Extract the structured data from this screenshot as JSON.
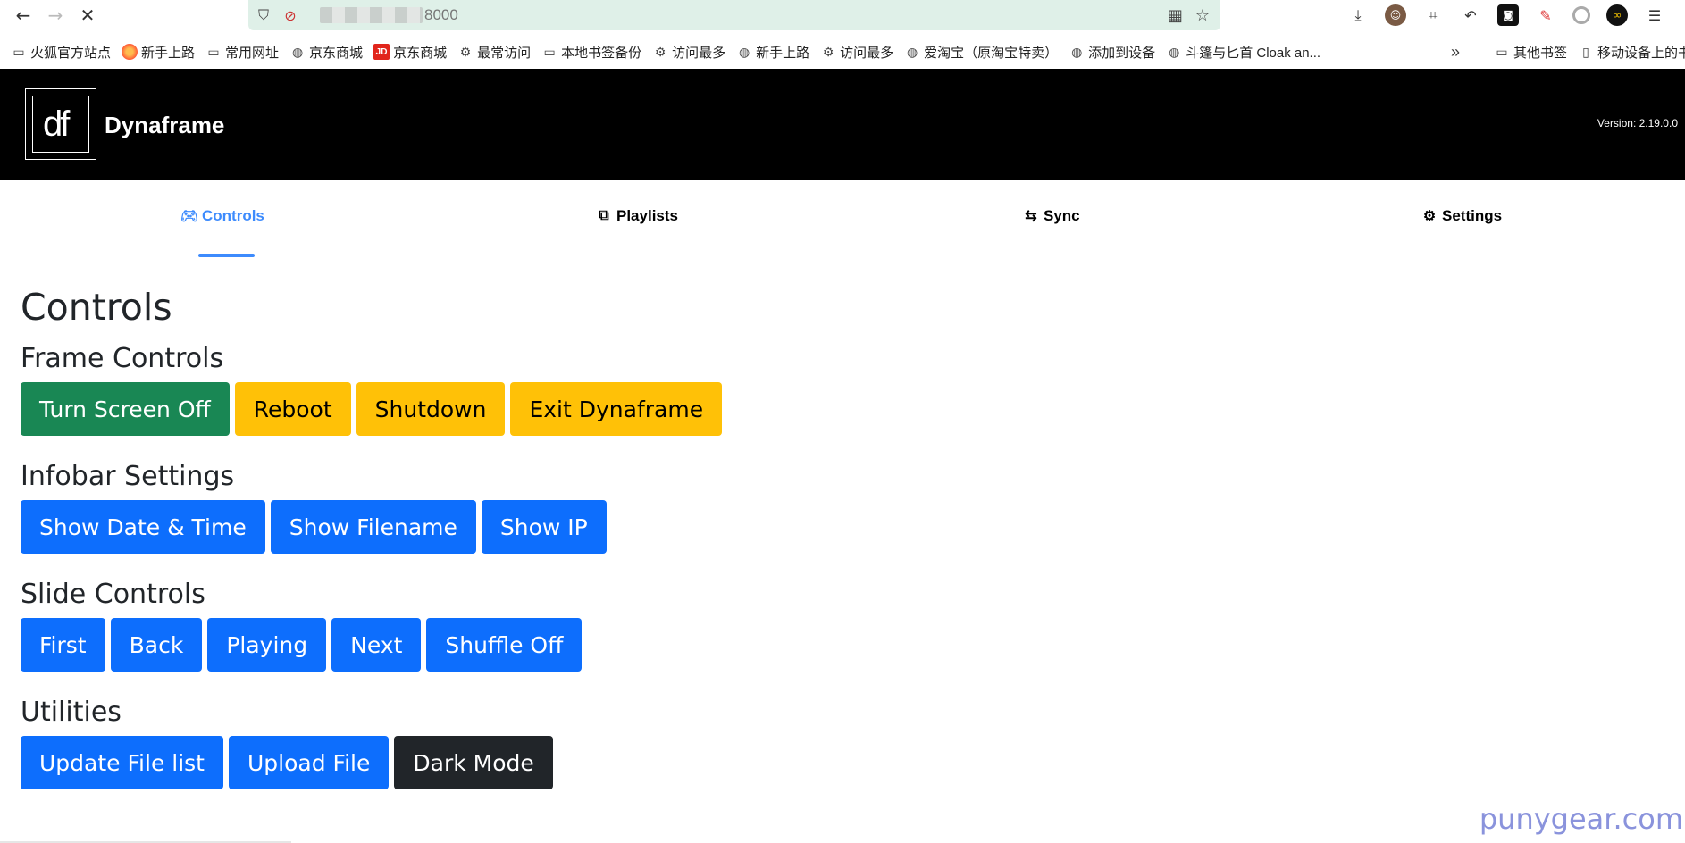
{
  "browser": {
    "url_port": "8000",
    "bookmarks": [
      "火狐官方站点",
      "新手上路",
      "常用网址",
      "京东商城",
      "京东商城",
      "最常访问",
      "本地书签备份",
      "访问最多",
      "新手上路",
      "访问最多",
      "爱淘宝（原淘宝特卖）",
      "添加到设备",
      "斗篷与匕首 Cloak an..."
    ],
    "other_bookmarks": "其他书签",
    "mobile_bookmarks": "移动设备上的书"
  },
  "app": {
    "brand": "Dynaframe",
    "logo_text": "df",
    "version": "Version: 2.19.0.0"
  },
  "tabs": [
    {
      "label": "Controls",
      "icon": "gamepad-icon",
      "active": true
    },
    {
      "label": "Playlists",
      "icon": "playlist-icon"
    },
    {
      "label": "Sync",
      "icon": "sync-arrows-icon"
    },
    {
      "label": "Settings",
      "icon": "gear-icon"
    }
  ],
  "page_title": "Controls",
  "sections": {
    "frame": {
      "title": "Frame Controls",
      "buttons": [
        "Turn Screen Off",
        "Reboot",
        "Shutdown",
        "Exit Dynaframe"
      ]
    },
    "infobar": {
      "title": "Infobar Settings",
      "buttons": [
        "Show Date & Time",
        "Show Filename",
        "Show IP"
      ]
    },
    "slide": {
      "title": "Slide Controls",
      "buttons": [
        "First",
        "Back",
        "Playing",
        "Next",
        "Shuffle Off"
      ]
    },
    "utilities": {
      "title": "Utilities",
      "buttons": [
        "Update File list",
        "Upload File",
        "Dark Mode"
      ]
    }
  },
  "watermark": "punygear.com",
  "colors": {
    "success": "#198754",
    "warning": "#ffc107",
    "primary": "#0d6efd",
    "dark": "#212529",
    "tab_active": "#3d8bfd"
  }
}
